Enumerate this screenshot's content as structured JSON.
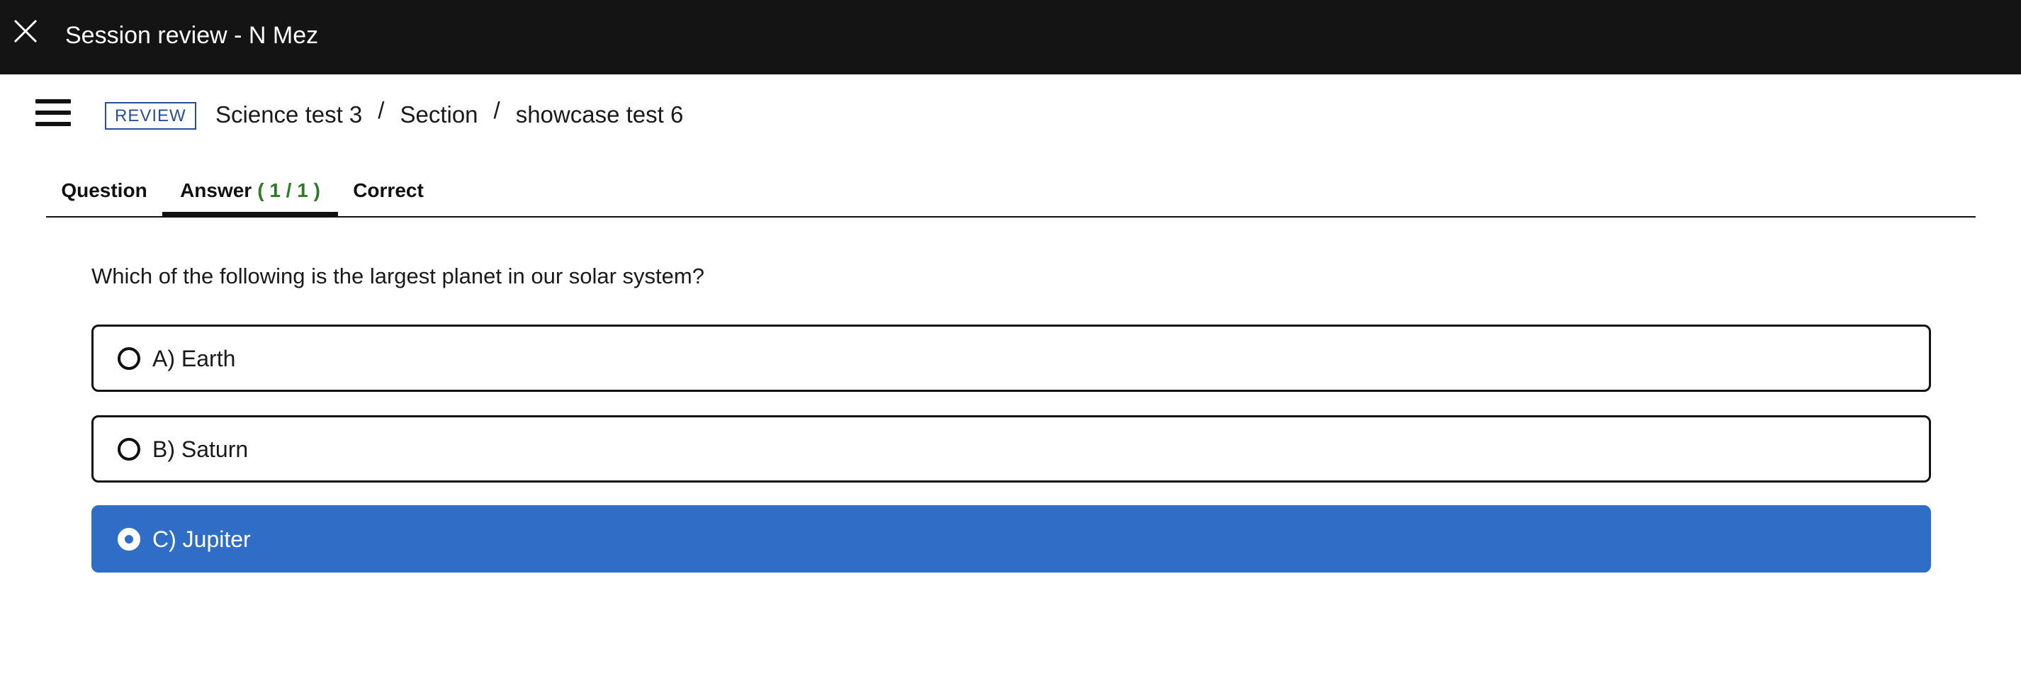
{
  "window": {
    "title": "Session review - N Mez",
    "close_icon": "close-icon"
  },
  "header": {
    "menu_icon": "hamburger-menu-icon",
    "badge": "REVIEW",
    "breadcrumb": {
      "items": [
        "Science test 3",
        "Section",
        "showcase test 6"
      ],
      "separator": "/"
    }
  },
  "tabs": {
    "question": "Question",
    "answer": "Answer",
    "answer_count": "( 1 / 1 )",
    "correct": "Correct",
    "active": "Answer"
  },
  "question": {
    "text": "Which of the following is the largest planet in our solar system?",
    "options": [
      {
        "label": "A) Earth",
        "selected": false
      },
      {
        "label": "B) Saturn",
        "selected": false
      },
      {
        "label": "C) Jupiter",
        "selected": true
      }
    ]
  },
  "colors": {
    "topbar_bg": "#141414",
    "badge_border": "#2a4f8f",
    "answer_count": "#2f7a2a",
    "selected_option_bg": "#2f6dc6",
    "text": "#1a1a1a"
  }
}
